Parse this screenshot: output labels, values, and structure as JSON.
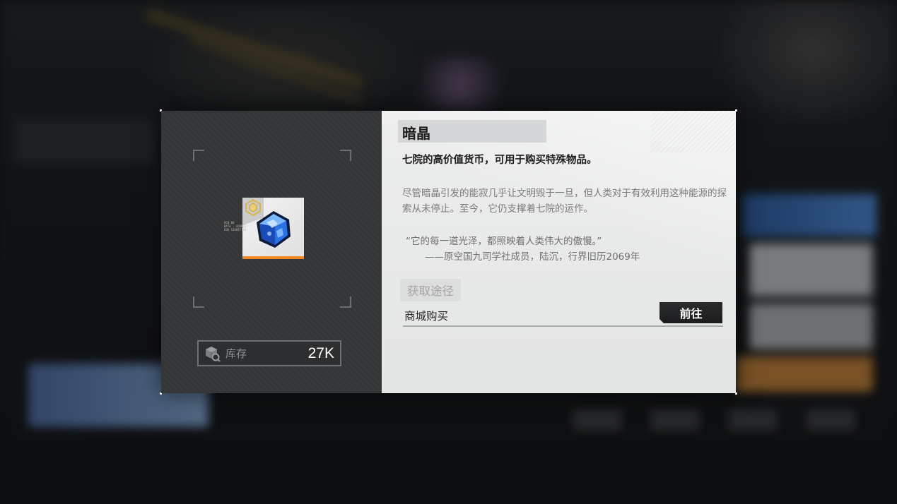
{
  "item": {
    "name": "暗晶",
    "summary": "七院的高价值货币，可用于购买特殊物品。",
    "description": "尽管暗晶引发的能寂几乎让文明毁于一旦，但人类对于有效利用这种能源的探索从未停止。至今，它仍支撑着七院的运作。",
    "quote": "“它的每一道光泽，都照映着人类伟大的傲慢。”",
    "quote_attribution": "——原空国九司学社成员，陆沉，行界旧历2069年",
    "card_micro_text": "DCN 00\nDATA - SOURCE\nCOO SIGNIFIER",
    "icon": "blue-crystal-gem-icon",
    "rarity_icon": "gold-polyhedron-rarity-icon",
    "rarity_color": "#f08a24"
  },
  "stock": {
    "label": "库存",
    "value": "27K",
    "icon": "package-search-icon"
  },
  "sources": {
    "header": "获取途径",
    "items": [
      {
        "name": "商城购买",
        "button_label": "前往"
      }
    ]
  },
  "colors": {
    "left_panel": "#333537",
    "right_panel": "#e6e7e7",
    "button": "#1f2022",
    "accent_bar": "#f08a24"
  }
}
